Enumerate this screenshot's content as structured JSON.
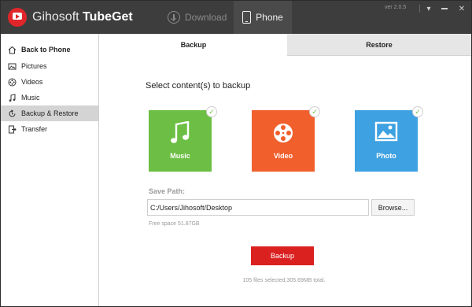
{
  "app": {
    "title_light": "Gihosoft",
    "title_bold": "TubeGet",
    "version": "ver 2.0.5"
  },
  "nav": {
    "download": "Download",
    "phone": "Phone"
  },
  "sidebar": {
    "header": "Back to Phone",
    "items": [
      {
        "label": "Pictures",
        "icon": "picture-icon"
      },
      {
        "label": "Videos",
        "icon": "film-reel-icon"
      },
      {
        "label": "Music",
        "icon": "music-note-icon"
      },
      {
        "label": "Backup & Restore",
        "icon": "backup-icon",
        "active": true
      },
      {
        "label": "Transfer",
        "icon": "transfer-icon"
      }
    ]
  },
  "tabs": {
    "backup": "Backup",
    "restore": "Restore"
  },
  "main": {
    "heading": "Select content(s) to backup",
    "tiles": [
      {
        "label": "Music",
        "color": "#6cbf44",
        "checked": true
      },
      {
        "label": "Video",
        "color": "#f05f2c",
        "checked": true
      },
      {
        "label": "Photo",
        "color": "#3ea1e1",
        "checked": true
      }
    ],
    "save_path_label": "Save Path:",
    "save_path_value": "C:/Users/Jihosoft/Desktop",
    "browse_label": "Browse...",
    "free_space": "Free space 51.87GB",
    "backup_button": "Backup",
    "summary": "105 files selected,305.69MB total."
  },
  "colors": {
    "accent_red": "#db2020",
    "titlebar": "#3d3d3d"
  }
}
